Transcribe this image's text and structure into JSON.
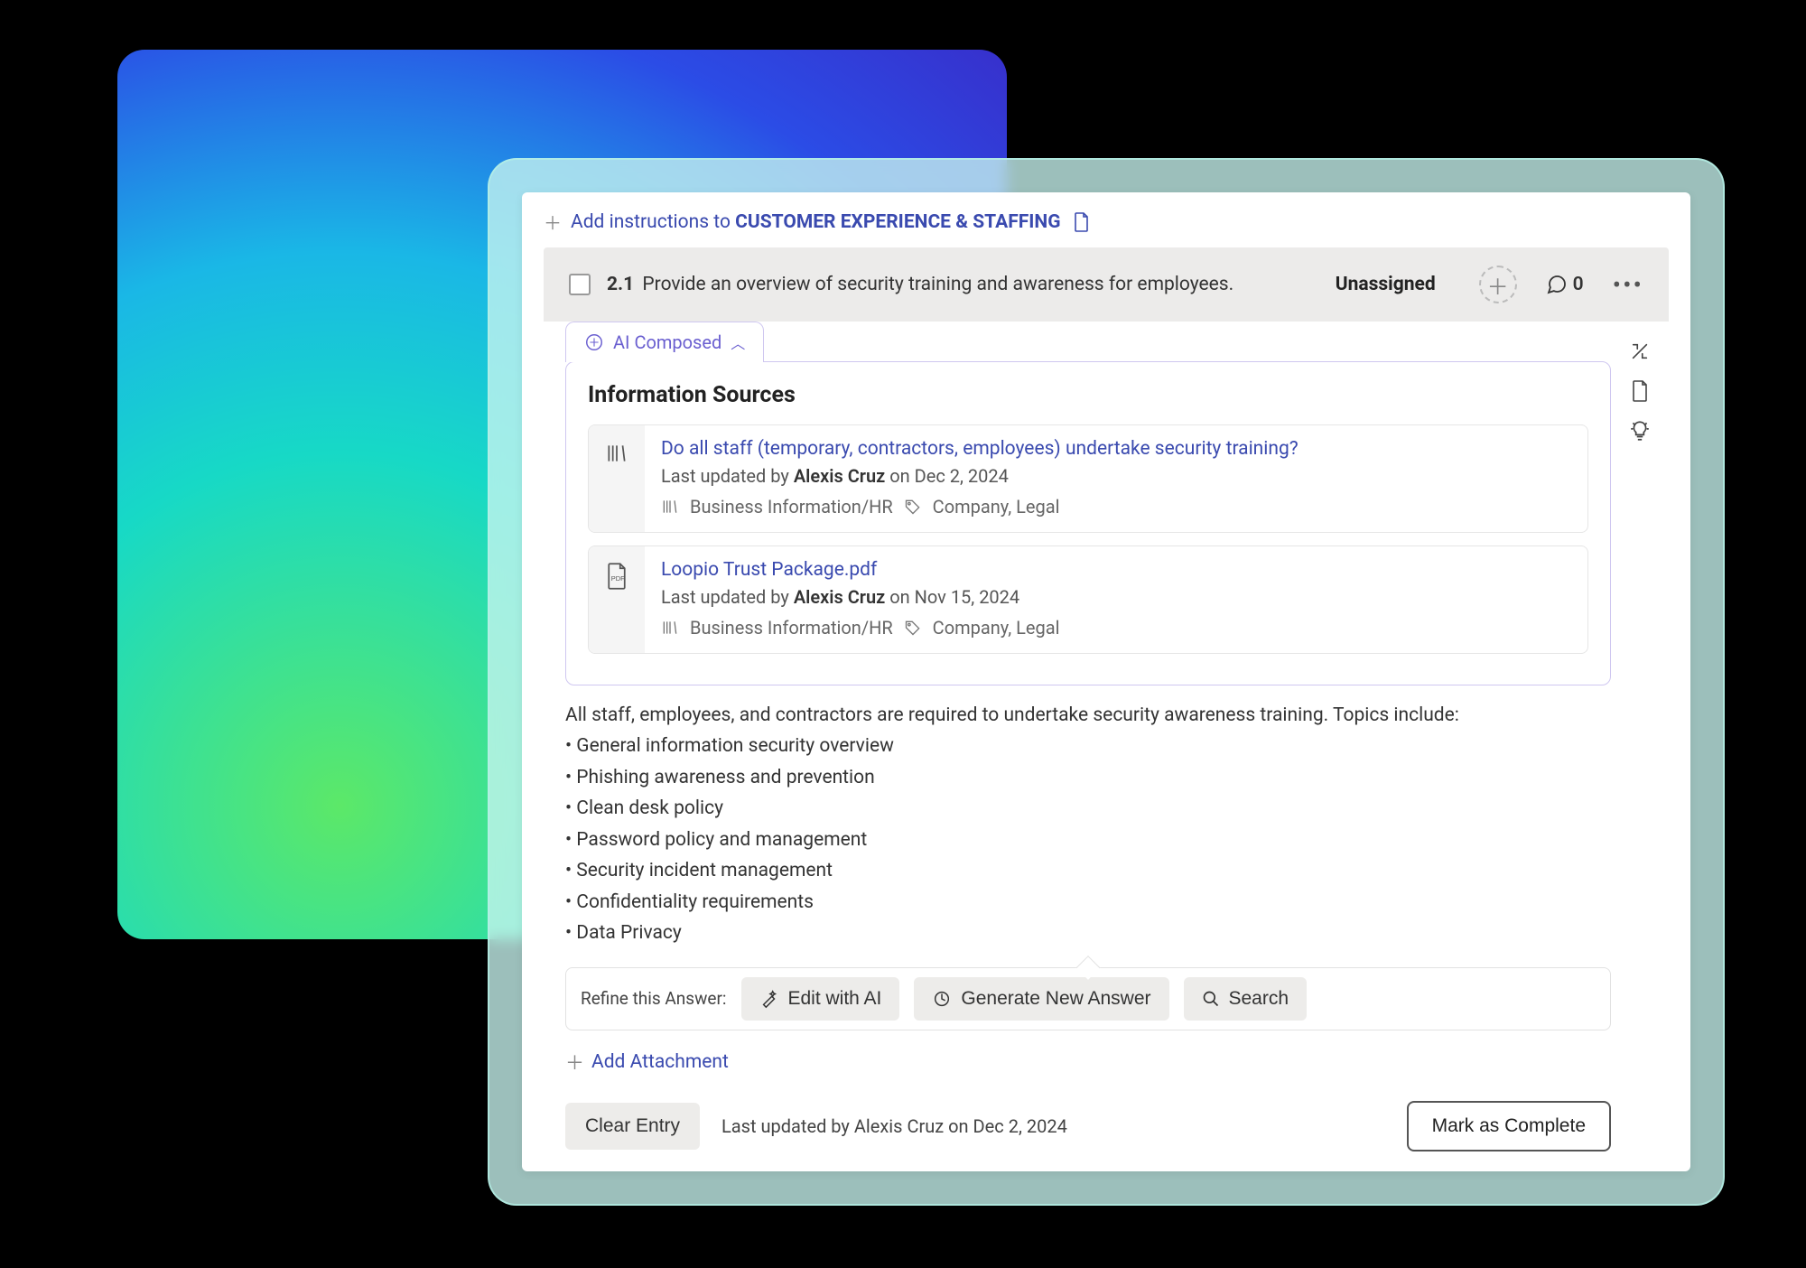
{
  "instructions": {
    "prefix": "Add instructions to ",
    "section": "CUSTOMER EXPERIENCE & STAFFING"
  },
  "question": {
    "number": "2.1",
    "text": "Provide an overview of security training and awareness for employees.",
    "assignee": "Unassigned",
    "comment_count": "0"
  },
  "ai_tab": {
    "label": "AI Composed"
  },
  "sources": {
    "title": "Information Sources",
    "items": [
      {
        "title": "Do all staff (temporary, contractors, employees) undertake security training?",
        "updated_prefix": "Last updated by ",
        "updated_by": "Alexis Cruz",
        "updated_on": " on Dec 2, 2024",
        "category": "Business Information/HR",
        "tags": "Company, Legal",
        "icon": "library"
      },
      {
        "title": "Loopio Trust Package.pdf",
        "updated_prefix": "Last updated by ",
        "updated_by": "Alexis Cruz",
        "updated_on": " on Nov 15, 2024",
        "category": "Business Information/HR",
        "tags": "Company, Legal",
        "icon": "pdf"
      }
    ]
  },
  "answer": {
    "intro": "All staff, employees, and contractors are required to undertake security awareness training. Topics include:",
    "bullets": [
      "• General information security overview",
      "• Phishing awareness and prevention",
      "• Clean desk policy",
      "• Password policy and management",
      "• Security incident management",
      "• Confidentiality requirements",
      "• Data Privacy"
    ]
  },
  "refine": {
    "label": "Refine this Answer:",
    "edit_ai": "Edit with AI",
    "generate": "Generate New Answer",
    "search": "Search"
  },
  "attachment": {
    "label": "Add Attachment"
  },
  "footer": {
    "clear": "Clear Entry",
    "meta": "Last updated by Alexis Cruz on Dec 2, 2024",
    "complete": "Mark as Complete"
  }
}
